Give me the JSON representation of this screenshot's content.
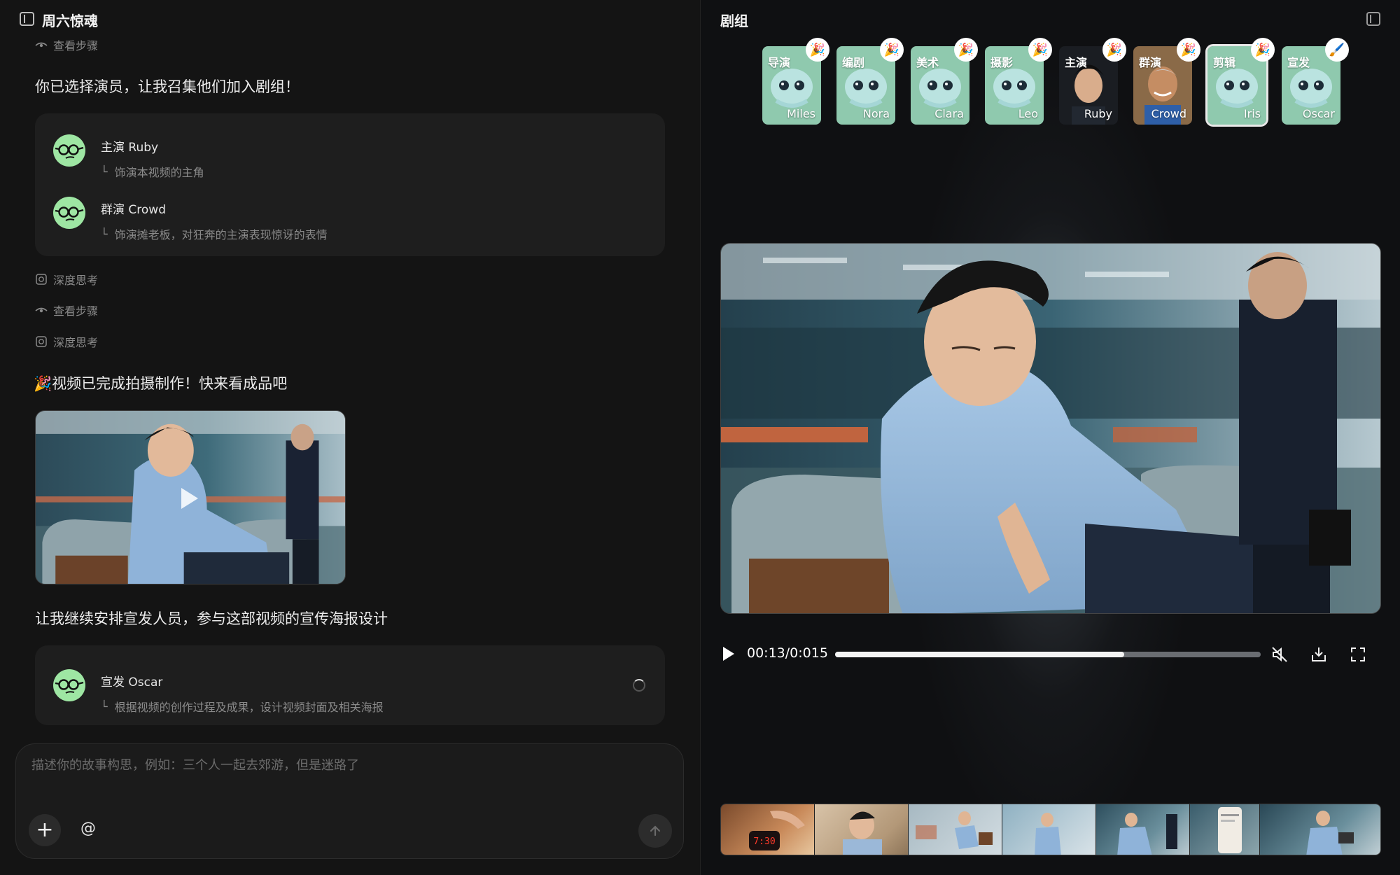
{
  "left": {
    "title": "周六惊魂",
    "top_meta": "查看步骤",
    "intro": "你已选择演员，让我召集他们加入剧组！",
    "cast": [
      {
        "name": "主演 Ruby",
        "desc": "饰演本视频的主角"
      },
      {
        "name": "群演 Crowd",
        "desc": "饰演摊老板，对狂奔的主演表现惊讶的表情"
      }
    ],
    "steps": [
      "深度思考",
      "查看步骤",
      "深度思考"
    ],
    "done_message": "🎉视频已完成拍摄制作！快来看成品吧",
    "continue_message": "让我继续安排宣发人员，参与这部视频的宣传海报设计",
    "promo": {
      "name": "宣发 Oscar",
      "desc": "根据视频的创作过程及成果，设计视频封面及相关海报"
    },
    "composer": {
      "placeholder": "描述你的故事构思，例如：三个人一起去郊游，但是迷路了",
      "at_label": "@"
    }
  },
  "right": {
    "title": "剧组",
    "crew": [
      {
        "role": "导演",
        "name": "Miles",
        "badge": "🎉",
        "kind": "robot"
      },
      {
        "role": "编剧",
        "name": "Nora",
        "badge": "🎉",
        "kind": "robot"
      },
      {
        "role": "美术",
        "name": "Clara",
        "badge": "🎉",
        "kind": "robot"
      },
      {
        "role": "摄影",
        "name": "Leo",
        "badge": "🎉",
        "kind": "robot"
      },
      {
        "role": "主演",
        "name": "Ruby",
        "badge": "🎉",
        "kind": "man"
      },
      {
        "role": "群演",
        "name": "Crowd",
        "badge": "🎉",
        "kind": "elder"
      },
      {
        "role": "剪辑",
        "name": "Iris",
        "badge": "🎉",
        "kind": "robot"
      },
      {
        "role": "宣发",
        "name": "Oscar",
        "badge": "🖌️",
        "kind": "robot"
      }
    ],
    "selected_crew": "Iris",
    "player": {
      "time": "00:13/0:015",
      "progress": 0.68
    },
    "filmstrip_clock": "7:30",
    "colors": {
      "accent_avatar": "#9ee6a3",
      "robot_card": "#8fc9ae"
    }
  }
}
